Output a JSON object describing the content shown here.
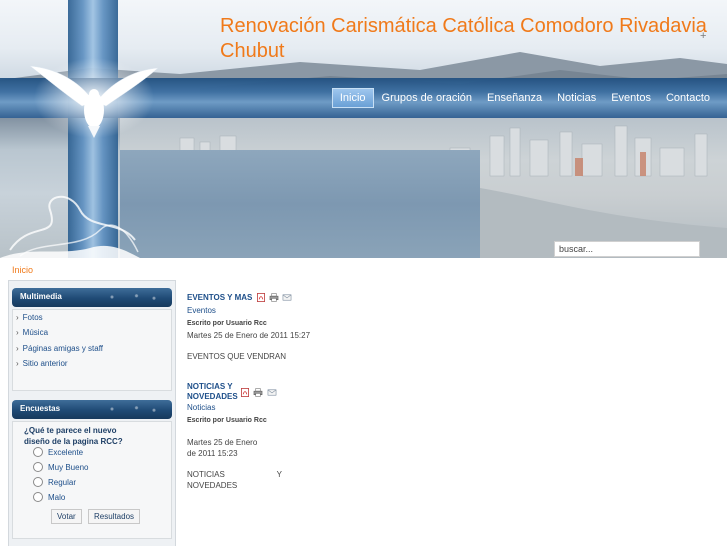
{
  "site": {
    "title": "Renovación Carismática Católica Comodoro Rivadavia Chubut"
  },
  "nav": {
    "items": [
      {
        "label": "Inicio",
        "active": true
      },
      {
        "label": "Grupos de oración"
      },
      {
        "label": "Enseñanza"
      },
      {
        "label": "Noticias"
      },
      {
        "label": "Eventos"
      },
      {
        "label": "Contacto"
      }
    ]
  },
  "search": {
    "value": "buscar..."
  },
  "breadcrumb": {
    "current": "Inicio"
  },
  "sidebar": {
    "multimedia": {
      "title": "Multimedia",
      "items": [
        "Fotos",
        "Música",
        "Páginas amigas y staff",
        "Sitio anterior"
      ]
    },
    "poll": {
      "title": "Encuestas",
      "question": "¿Qué te parece el nuevo diseño de la pagina RCC?",
      "options": [
        "Excelente",
        "Muy Bueno",
        "Regular",
        "Malo"
      ],
      "vote_label": "Votar",
      "results_label": "Resultados"
    }
  },
  "articles": [
    {
      "title": "EVENTOS Y MAS",
      "category": "Eventos",
      "author": "Escrito por Usuario Rcc",
      "date": "Martes 25 de Enero de 2011 15:27",
      "body": "EVENTOS QUE VENDRAN",
      "icons": [
        "pdf-icon",
        "print-icon",
        "email-icon"
      ]
    },
    {
      "title": "NOTICIAS Y NOVEDADES",
      "category": "Noticias",
      "author": "Escrito por Usuario Rcc",
      "date": "Martes 25 de Enero de 2011 15:23",
      "body": "NOTICIAS Y NOVEDADES",
      "icons": [
        "pdf-icon",
        "print-icon",
        "email-icon"
      ]
    }
  ],
  "colors": {
    "title_orange": "#f07a1a",
    "link_blue": "#1e4f8a",
    "module_header_blue": "#1f4a75"
  }
}
